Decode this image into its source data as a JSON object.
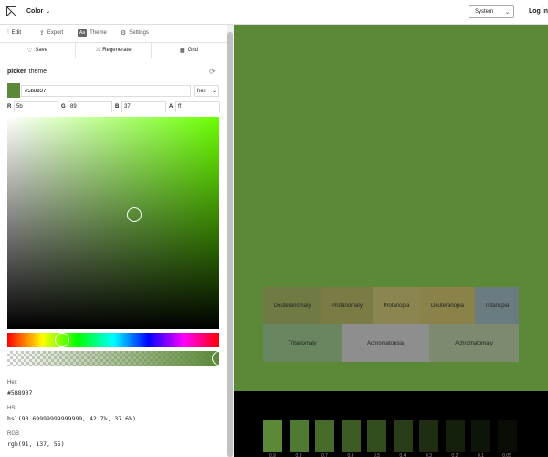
{
  "header": {
    "menu_label": "Color",
    "theme_select": "System",
    "login_label": "Log in"
  },
  "tabs": [
    {
      "label": "Edit",
      "icon": "sliders-icon",
      "active": true
    },
    {
      "label": "Export",
      "icon": "export-icon",
      "active": false
    },
    {
      "label": "Theme",
      "icon": "aa-icon",
      "badge": "Aa",
      "active": false
    },
    {
      "label": "Settings",
      "icon": "gear-icon",
      "active": false
    }
  ],
  "toolbar": {
    "save_label": "Save",
    "regenerate_label": "Regenerate",
    "grid_label": "Grid"
  },
  "picker": {
    "title": "picker",
    "subtitle": "theme",
    "hex_value": "#5b8937",
    "format": "hex",
    "channels": [
      {
        "label": "R",
        "value": "5b"
      },
      {
        "label": "G",
        "value": "89"
      },
      {
        "label": "B",
        "value": "37"
      },
      {
        "label": "A",
        "value": "ff"
      }
    ],
    "saturation": 0.598,
    "brightness": 0.537,
    "hue_fraction": 0.26,
    "alpha": 1.0
  },
  "info": {
    "hex_label": "Hex",
    "hex_value": "#5B8937",
    "hsl_label": "HSL",
    "hsl_value": "hsl(93.69999999999999, 42.7%, 37.6%)",
    "rgb_label": "RGB",
    "rgb_value": "rgb(91, 137, 55)"
  },
  "colors": {
    "accent": "#5b8937",
    "hue_pure": "#6aff00",
    "alpha_start": "rgba(91,137,55,0)",
    "alpha_end": "#5b8937"
  },
  "cvd": {
    "row1": [
      {
        "label": "Deuteranomaly",
        "color": "#6f7a45"
      },
      {
        "label": "Protanomaly",
        "color": "#7a7b45"
      },
      {
        "label": "Protanopia",
        "color": "#8b8550"
      },
      {
        "label": "Deuteranopia",
        "color": "#8a8248"
      },
      {
        "label": "Tritanopia",
        "color": "#6a7c80"
      }
    ],
    "row2": [
      {
        "label": "Tritanomaly",
        "color": "#6a8660"
      },
      {
        "label": "Achromatopsia",
        "color": "#8e8e8e"
      },
      {
        "label": "Achromatomaly",
        "color": "#7d8a70"
      }
    ]
  },
  "shades": [
    {
      "label": "0.9",
      "color": "#5b8937"
    },
    {
      "label": "0.8",
      "color": "#507a31"
    },
    {
      "label": "0.7",
      "color": "#476b2b"
    },
    {
      "label": "0.6",
      "color": "#3d5c25"
    },
    {
      "label": "0.5",
      "color": "#334d1f"
    },
    {
      "label": "0.4",
      "color": "#293d19"
    },
    {
      "label": "0.3",
      "color": "#1f2e13"
    },
    {
      "label": "0.2",
      "color": "#141f0c"
    },
    {
      "label": "0.1",
      "color": "#0d1408"
    },
    {
      "label": "0.05",
      "color": "#080c05"
    }
  ]
}
